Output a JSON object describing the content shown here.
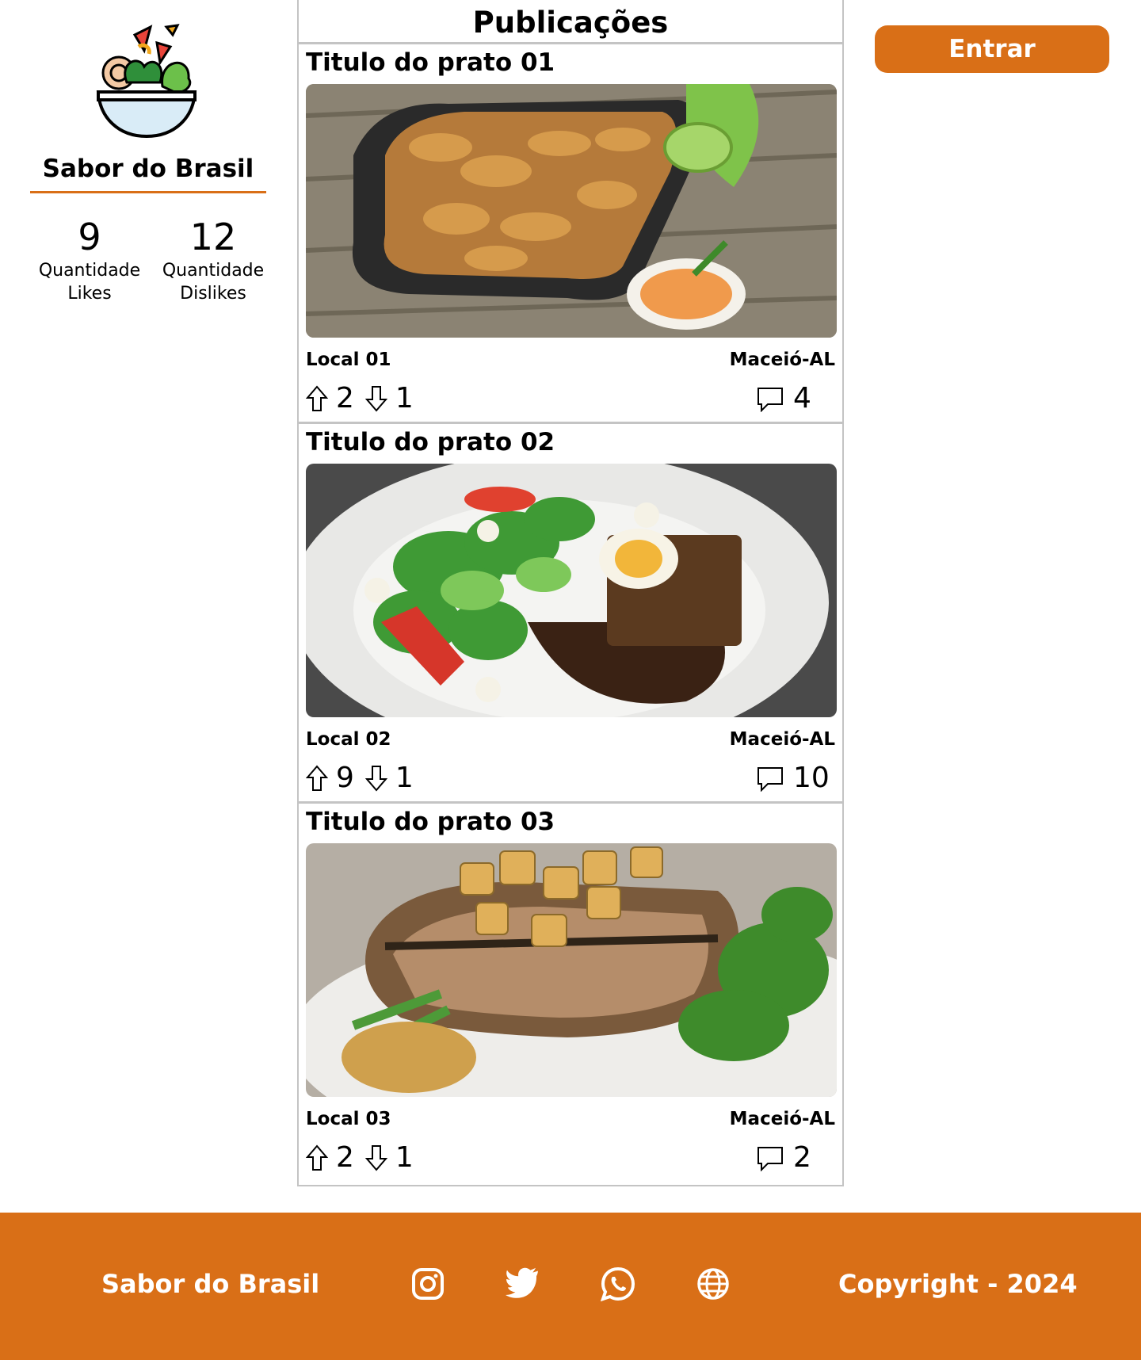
{
  "sidebar": {
    "brand_name": "Sabor do Brasil",
    "stats": [
      {
        "value": "9",
        "label_line1": "Quantidade",
        "label_line2": "Likes"
      },
      {
        "value": "12",
        "label_line1": "Quantidade",
        "label_line2": "Dislikes"
      }
    ]
  },
  "feed": {
    "title": "Publicações",
    "posts": [
      {
        "title": "Titulo do prato 01",
        "local": "Local 01",
        "city": "Maceió-AL",
        "upvotes": "2",
        "downvotes": "1",
        "comments": "4"
      },
      {
        "title": "Titulo do prato 02",
        "local": "Local 02",
        "city": "Maceió-AL",
        "upvotes": "9",
        "downvotes": "1",
        "comments": "10"
      },
      {
        "title": "Titulo do prato 03",
        "local": "Local 03",
        "city": "Maceió-AL",
        "upvotes": "2",
        "downvotes": "1",
        "comments": "2"
      }
    ]
  },
  "header": {
    "login_label": "Entrar"
  },
  "footer": {
    "brand": "Sabor do Brasil",
    "copyright": "Copyright - 2024",
    "social_icons": [
      "instagram-icon",
      "twitter-icon",
      "whatsapp-icon",
      "globe-icon"
    ]
  },
  "colors": {
    "accent": "#d96f17",
    "border": "#c4c4c4"
  }
}
